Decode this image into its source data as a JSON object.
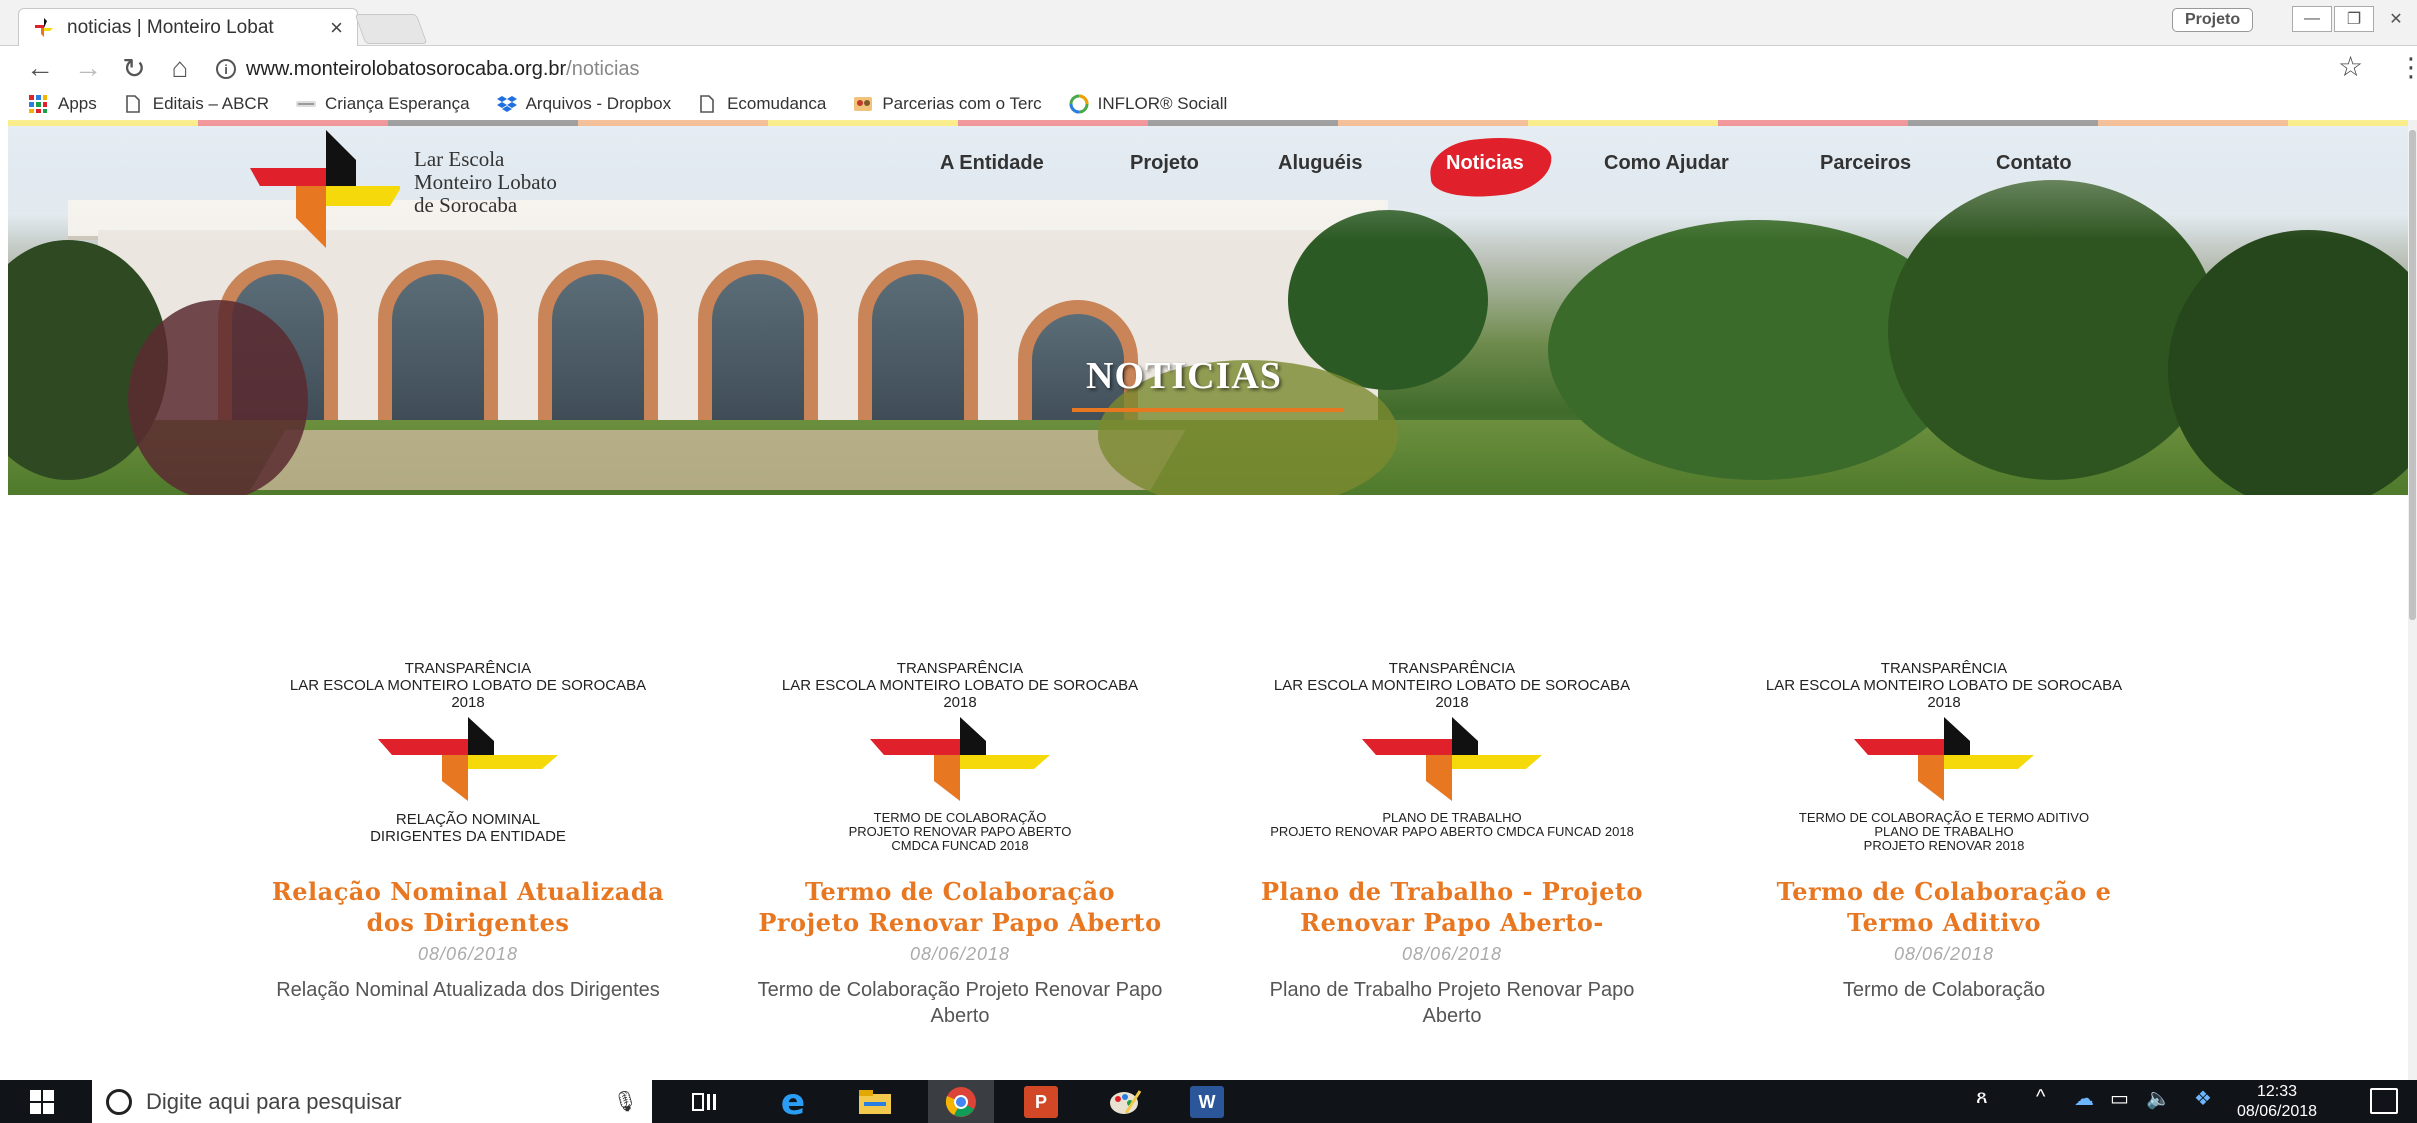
{
  "browser": {
    "tab_title": "noticias | Monteiro Lobat",
    "tab_close": "×",
    "profile_label": "Projeto",
    "url_host": "www.monteirolobatosorocaba.org.br",
    "url_path": "/noticias",
    "bookmarks": [
      {
        "label": "Apps",
        "icon": "apps-grid-icon"
      },
      {
        "label": "Editais – ABCR",
        "icon": "page-icon"
      },
      {
        "label": "Criança Esperança",
        "icon": "esperanca-icon"
      },
      {
        "label": "Arquivos - Dropbox",
        "icon": "dropbox-icon"
      },
      {
        "label": "Ecomudanca",
        "icon": "page-icon"
      },
      {
        "label": "Parcerias com o Terc",
        "icon": "parcerias-icon"
      },
      {
        "label": "INFLOR® Sociall",
        "icon": "inflor-icon"
      }
    ]
  },
  "site": {
    "logo_lines": [
      "Lar Escola",
      "Monteiro Lobato",
      "de Sorocaba"
    ],
    "nav": [
      "A Entidade",
      "Projeto",
      "Aluguéis",
      "Noticias",
      "Como Ajudar",
      "Parceiros",
      "Contato"
    ],
    "active_nav": "Noticias",
    "hero_title": "NOTICIAS",
    "accent_color": "#e87722",
    "cards": [
      {
        "thumb_head": [
          "TRANSPARÊNCIA",
          "LAR ESCOLA MONTEIRO LOBATO DE SOROCABA",
          "2018"
        ],
        "thumb_foot": [
          "RELAÇÃO NOMINAL",
          "DIRIGENTES DA ENTIDADE"
        ],
        "title": "Relação Nominal Atualizada dos Dirigentes",
        "date": "08/06/2018",
        "summary": "Relação Nominal Atualizada dos Dirigentes"
      },
      {
        "thumb_head": [
          "TRANSPARÊNCIA",
          "LAR ESCOLA MONTEIRO LOBATO DE SOROCABA",
          "2018"
        ],
        "thumb_foot": [
          "TERMO DE COLABORAÇÃO",
          "PROJETO RENOVAR PAPO ABERTO",
          "CMDCA FUNCAD 2018"
        ],
        "title": "Termo de Colaboração Projeto Renovar Papo Aberto",
        "date": "08/06/2018",
        "summary": "Termo de Colaboração Projeto Renovar Papo Aberto"
      },
      {
        "thumb_head": [
          "TRANSPARÊNCIA",
          "LAR ESCOLA MONTEIRO LOBATO DE SOROCABA",
          "2018"
        ],
        "thumb_foot": [
          "PLANO DE TRABALHO",
          "PROJETO RENOVAR PAPO ABERTO CMDCA FUNCAD 2018"
        ],
        "title": "Plano de Trabalho - Projeto Renovar Papo Aberto-",
        "date": "08/06/2018",
        "summary": "Plano de Trabalho Projeto Renovar Papo Aberto"
      },
      {
        "thumb_head": [
          "TRANSPARÊNCIA",
          "LAR ESCOLA MONTEIRO LOBATO DE SOROCABA",
          "2018"
        ],
        "thumb_foot": [
          "TERMO DE COLABORAÇÃO E TERMO ADITIVO",
          "PLANO DE TRABALHO",
          "PROJETO RENOVAR 2018"
        ],
        "title": "Termo de Colaboração e Termo Aditivo",
        "date": "08/06/2018",
        "summary": "Termo de Colaboração"
      }
    ]
  },
  "taskbar": {
    "search_placeholder": "Digite aqui para pesquisar",
    "apps": [
      "task-view-icon",
      "edge-icon",
      "file-explorer-icon",
      "chrome-icon",
      "powerpoint-icon",
      "paint-icon",
      "word-icon"
    ],
    "time": "12:33",
    "date": "08/06/2018"
  }
}
